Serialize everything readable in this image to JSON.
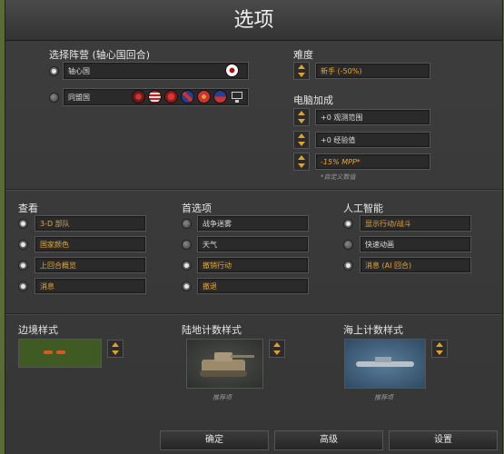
{
  "window": {
    "title": "选项"
  },
  "side": {
    "label": "选择阵营 (轴心国回合)",
    "axis": "轴心国",
    "allies": "同盟国"
  },
  "difficulty": {
    "label": "难度",
    "value": "新手 (-50%)"
  },
  "ai_bonus": {
    "label": "电脑加成",
    "vision": "+0 观测范围",
    "experience": "+0 经验值",
    "mpp": "-15% MPP*",
    "note": "*自定义数值"
  },
  "view": {
    "label": "查看",
    "items": [
      "3-D 部队",
      "国家颜色",
      "上回合概览",
      "消息"
    ]
  },
  "prefs": {
    "label": "首选项",
    "items": [
      "战争迷雾",
      "天气",
      "撤销行动",
      "撤退"
    ]
  },
  "ai": {
    "label": "人工智能",
    "items": [
      "显示行动/战斗",
      "快速动画",
      "消息 (AI 回合)"
    ]
  },
  "border": {
    "label": "边境样式"
  },
  "land": {
    "label": "陆地计数样式",
    "hint": "推荐项"
  },
  "sea": {
    "label": "海上计数样式",
    "hint": "推荐项"
  },
  "buttons": {
    "ok": "确定",
    "advanced": "高级",
    "settings": "设置"
  },
  "colors": {
    "accent": "#e8a634",
    "panel": "#3a3a3a",
    "border_sample": "#3f5a22"
  }
}
